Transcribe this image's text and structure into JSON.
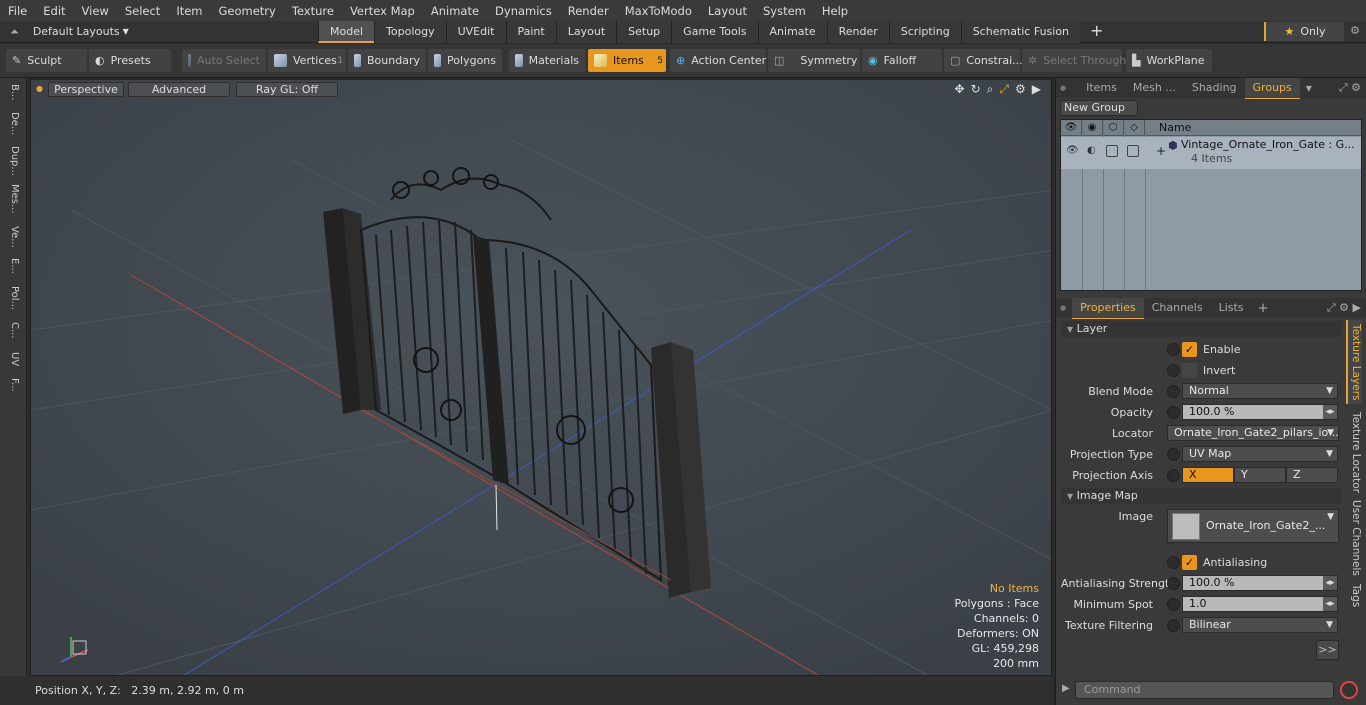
{
  "menu": [
    "File",
    "Edit",
    "View",
    "Select",
    "Item",
    "Geometry",
    "Texture",
    "Vertex Map",
    "Animate",
    "Dynamics",
    "Render",
    "MaxToModo",
    "Layout",
    "System",
    "Help"
  ],
  "layout_selector": "Default Layouts",
  "mode_tabs": [
    "Model",
    "Topology",
    "UVEdit",
    "Paint",
    "Layout",
    "Setup",
    "Game Tools",
    "Animate",
    "Render",
    "Scripting",
    "Schematic Fusion"
  ],
  "active_mode": "Model",
  "only_label": "Only",
  "toolbar": {
    "sculpt": "Sculpt",
    "presets": "Presets",
    "auto_select": "Auto Select",
    "vertices": "Vertices",
    "vertices_count": "1",
    "boundary": "Boundary",
    "polygons": "Polygons",
    "materials": "Materials",
    "items": "Items",
    "items_count": "5",
    "action_center": "Action Center",
    "symmetry": "Symmetry",
    "falloff": "Falloff",
    "constraints": "Constrai...",
    "select_through": "Select Through",
    "workplane": "WorkPlane"
  },
  "left_tabs": [
    "B...",
    "De...",
    "Dup...",
    "Mes...",
    "Ve...",
    "E...",
    "Pol...",
    "C...",
    "UV",
    "F..."
  ],
  "viewport": {
    "view": "Perspective",
    "shading": "Advanced",
    "raygl": "Ray GL: Off",
    "info": {
      "no_items": "No Items",
      "polygons": "Polygons : Face",
      "channels": "Channels: 0",
      "deformers": "Deformers: ON",
      "gl": "GL: 459,298",
      "scale": "200 mm"
    }
  },
  "status": "Position X, Y, Z:   2.39 m, 2.92 m, 0 m",
  "groups_panel": {
    "tabs": [
      "Items",
      "Mesh ...",
      "Shading",
      "Groups"
    ],
    "active_tab": "Groups",
    "new_group": "New Group",
    "col_name": "Name",
    "row_name": "Vintage_Ornate_Iron_Gate : G...",
    "row_sub": "4 Items"
  },
  "properties_panel": {
    "tabs": [
      "Properties",
      "Channels",
      "Lists"
    ],
    "active_tab": "Properties",
    "layer_section": "Layer",
    "enable": "Enable",
    "invert": "Invert",
    "blend_mode_label": "Blend Mode",
    "blend_mode": "Normal",
    "opacity_label": "Opacity",
    "opacity": "100.0 %",
    "locator_label": "Locator",
    "locator": "Ornate_Iron_Gate2_pilars_io ...",
    "projection_type_label": "Projection Type",
    "projection_type": "UV Map",
    "projection_axis_label": "Projection Axis",
    "axis_x": "X",
    "axis_y": "Y",
    "axis_z": "Z",
    "image_map_section": "Image Map",
    "image_label": "Image",
    "image": "Ornate_Iron_Gate2_...",
    "antialiasing": "Antialiasing",
    "aa_strength_label": "Antialiasing Strength",
    "aa_strength": "100.0 %",
    "min_spot_label": "Minimum Spot",
    "min_spot": "1.0",
    "tex_filter_label": "Texture Filtering",
    "tex_filter": "Bilinear",
    "more": ">>"
  },
  "side_tabs": [
    "Texture Layers",
    "Texture Locator",
    "User Channels",
    "Tags"
  ],
  "active_side_tab": "Texture Layers",
  "command_placeholder": "Command",
  "colors": {
    "accent": "#e8961e",
    "viewport_bg": "#414850"
  }
}
